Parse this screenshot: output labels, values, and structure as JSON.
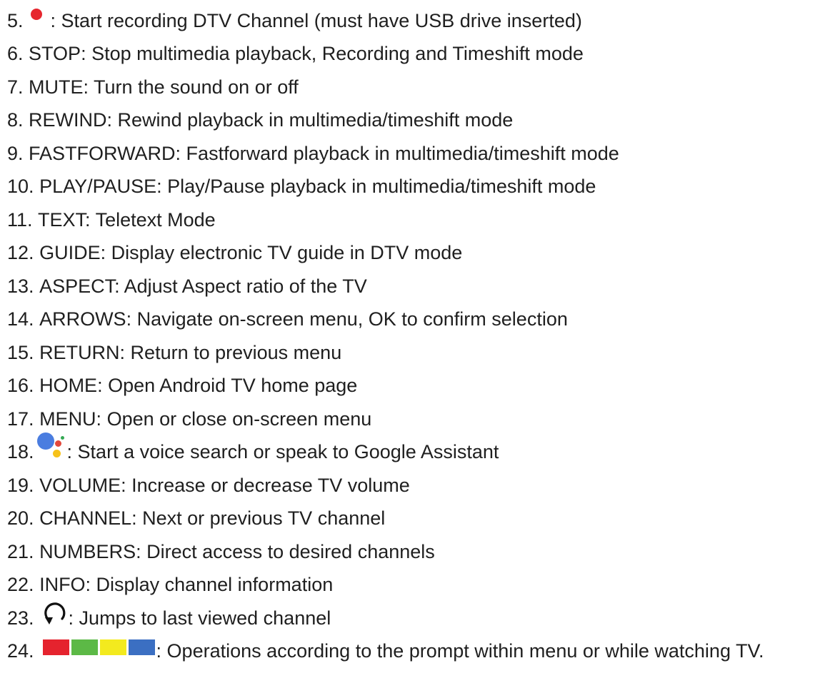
{
  "items": [
    {
      "num": "5.",
      "text": ": Start recording DTV Channel (must have USB drive inserted)",
      "icon": "record-dot-icon"
    },
    {
      "num": "6.",
      "text": "STOP: Stop multimedia playback, Recording and Timeshift mode"
    },
    {
      "num": "7.",
      "text": "MUTE: Turn the sound on or off"
    },
    {
      "num": "8.",
      "text": "REWIND: Rewind playback in multimedia/timeshift mode"
    },
    {
      "num": "9.",
      "text": "FASTFORWARD: Fastforward playback in multimedia/timeshift mode"
    },
    {
      "num": "10.",
      "text": "PLAY/PAUSE: Play/Pause playback in multimedia/timeshift mode"
    },
    {
      "num": "11.",
      "text": "TEXT: Teletext Mode"
    },
    {
      "num": "12.",
      "text": "GUIDE: Display electronic TV guide in DTV mode"
    },
    {
      "num": "13.",
      "text": "ASPECT: Adjust Aspect ratio of the TV"
    },
    {
      "num": "14.",
      "text": "ARROWS: Navigate on-screen menu, OK to confirm selection"
    },
    {
      "num": "15.",
      "text": "RETURN: Return to previous menu"
    },
    {
      "num": "16.",
      "text": "HOME: Open Android TV home page"
    },
    {
      "num": "17.",
      "text": "MENU: Open or close on-screen menu"
    },
    {
      "num": "18.",
      "text": ": Start a voice search or speak to Google Assistant",
      "icon": "google-assistant-icon"
    },
    {
      "num": "19.",
      "text": "VOLUME: Increase or decrease TV volume"
    },
    {
      "num": "20.",
      "text": "CHANNEL: Next or previous TV channel"
    },
    {
      "num": "21.",
      "text": "NUMBERS: Direct access to desired channels"
    },
    {
      "num": "22.",
      "text": "INFO: Display channel information"
    },
    {
      "num": "23.",
      "text": ": Jumps to last viewed channel",
      "icon": "last-channel-icon"
    },
    {
      "num": "24.",
      "text": ": Operations according to the prompt within menu or while watching TV.",
      "icon": "color-buttons-icon"
    }
  ],
  "colors": {
    "record": "#e6262e",
    "color_buttons": [
      "#e5232e",
      "#5cb946",
      "#f3ea1e",
      "#3b6fc2"
    ]
  }
}
